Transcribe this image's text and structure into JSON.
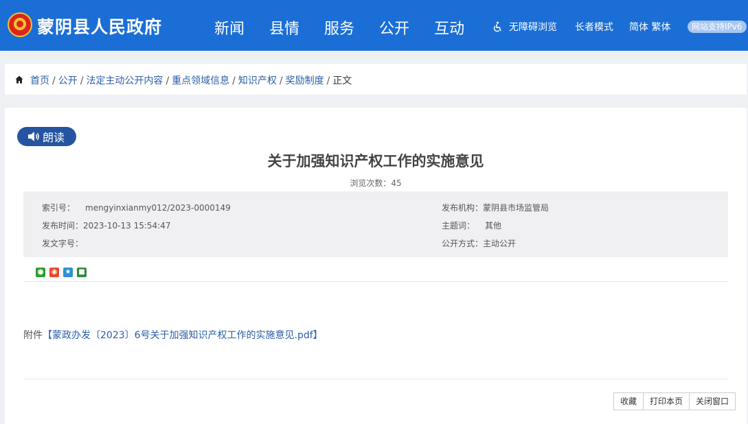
{
  "header": {
    "site_title": "蒙阴县人民政府",
    "nav": [
      "新闻",
      "县情",
      "服务",
      "公开",
      "互动"
    ],
    "accessibility_label": "无障碍浏览",
    "elder_mode_label": "长者模式",
    "language_label": "简体 繁体",
    "ipv6_badge": "网站支持IPv6",
    "brand_color": "#1a6ed6"
  },
  "breadcrumb": {
    "items": [
      "首页",
      "公开",
      "法定主动公开内容",
      "重点领域信息",
      "知识产权",
      "奖励制度"
    ],
    "current": "正文"
  },
  "article": {
    "read_button": "朗读",
    "title": "关于加强知识产权工作的实施意见",
    "views_label": "浏览次数：",
    "views_count": "45",
    "meta": {
      "index_label": "索引号：",
      "index_value": "mengyinxianmy012/2023-0000149",
      "publisher_label": "发布机构：",
      "publisher_value": "蒙阴县市场监管局",
      "date_label": "发布时间：",
      "date_value": "2023-10-13 15:54:47",
      "subject_label": "主题词：",
      "subject_value": "其他",
      "doc_number_label": "发文字号：",
      "doc_number_value": "",
      "open_mode_label": "公开方式：",
      "open_mode_value": "主动公开"
    },
    "share_icons": [
      "wechat-icon",
      "weibo-icon",
      "qzone-icon",
      "douban-icon"
    ],
    "attachment_prefix": "附件",
    "attachment_link": "【蒙政办发〔2023〕6号关于加强知识产权工作的实施意见.pdf】"
  },
  "actions": {
    "favorite": "收藏",
    "print": "打印本页",
    "close": "关闭窗口"
  }
}
